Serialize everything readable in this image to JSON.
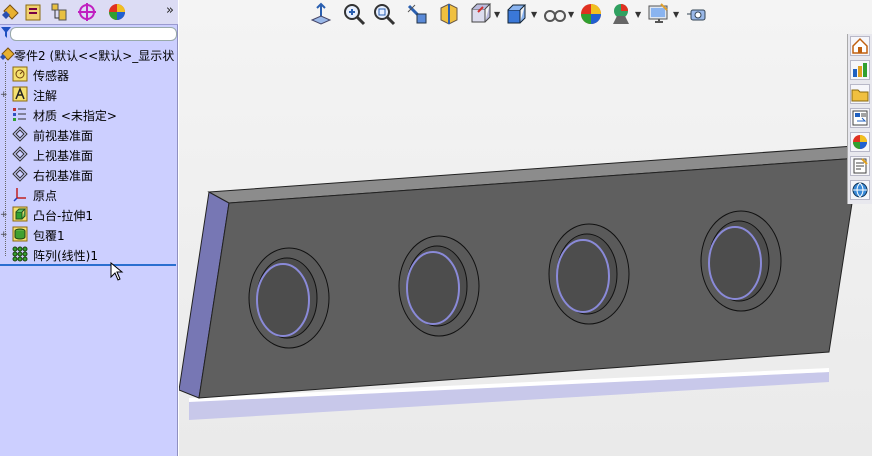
{
  "panel_tabs": [
    {
      "icon": "feature-manager-icon"
    },
    {
      "icon": "property-manager-icon"
    },
    {
      "icon": "configuration-manager-icon"
    },
    {
      "icon": "dimxpert-icon"
    },
    {
      "icon": "display-manager-icon"
    }
  ],
  "panel_expand_label": "»",
  "tree": {
    "root": "零件2 (默认<<默认>_显示状",
    "items": [
      {
        "label": "传感器",
        "icon": "sensor-icon"
      },
      {
        "label": "注解",
        "icon": "annotations-icon"
      },
      {
        "label": "材质 <未指定>",
        "icon": "material-icon"
      },
      {
        "label": "前视基准面",
        "icon": "plane-icon"
      },
      {
        "label": "上视基准面",
        "icon": "plane-icon"
      },
      {
        "label": "右视基准面",
        "icon": "plane-icon"
      },
      {
        "label": "原点",
        "icon": "origin-icon"
      },
      {
        "label": "凸台-拉伸1",
        "icon": "boss-extrude-icon"
      },
      {
        "label": "包覆1",
        "icon": "wrap-icon"
      },
      {
        "label": "阵列(线性)1",
        "icon": "linear-pattern-icon"
      }
    ]
  },
  "view_toolbar": [
    "normal-to-icon",
    "zoom-to-fit-icon",
    "zoom-area-icon",
    "previous-view-icon",
    "section-view-icon",
    "view-orientation-icon",
    "display-style-icon",
    "hide-show-items-icon",
    "edit-appearance-icon",
    "apply-scene-icon",
    "view-settings-icon",
    "screen-capture-icon"
  ],
  "task_pane": [
    "solidworks-resources-icon",
    "design-library-icon",
    "file-explorer-icon",
    "view-palette-icon",
    "appearances-icon",
    "custom-properties-icon",
    "3d-content-central-icon"
  ],
  "colors": {
    "panel_bg": "#cccfff",
    "plate_front": "#5f5f5f",
    "plate_side": "#7777b4",
    "rollback_bar": "#2a6fd0"
  }
}
